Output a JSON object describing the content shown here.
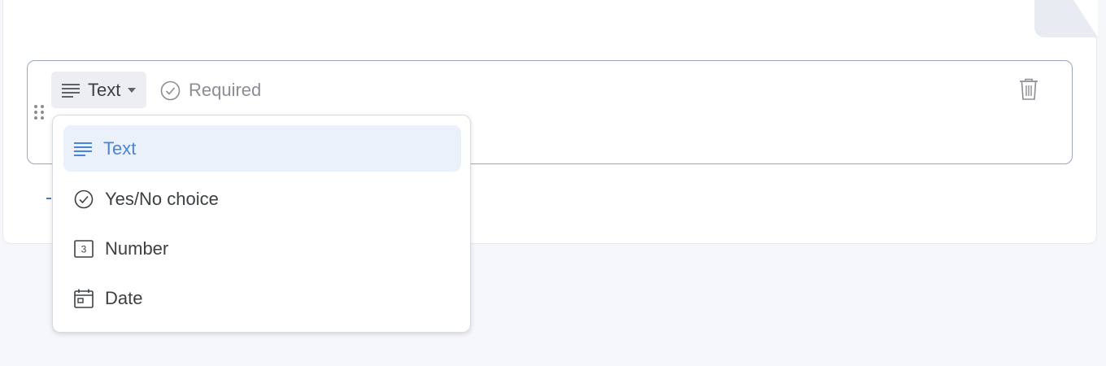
{
  "field": {
    "type_label": "Text",
    "required_label": "Required"
  },
  "menu": {
    "items": [
      {
        "label": "Text",
        "icon": "text-lines-icon",
        "selected": true
      },
      {
        "label": "Yes/No choice",
        "icon": "check-circle-icon",
        "selected": false
      },
      {
        "label": "Number",
        "icon": "number-box-icon",
        "number_glyph": "3",
        "selected": false
      },
      {
        "label": "Date",
        "icon": "calendar-icon",
        "selected": false
      }
    ]
  },
  "colors": {
    "accent": "#4a84d4",
    "selected_bg": "#eaf1fb",
    "field_border": "#9aa6c2",
    "page_bg": "#f6f7fb"
  }
}
